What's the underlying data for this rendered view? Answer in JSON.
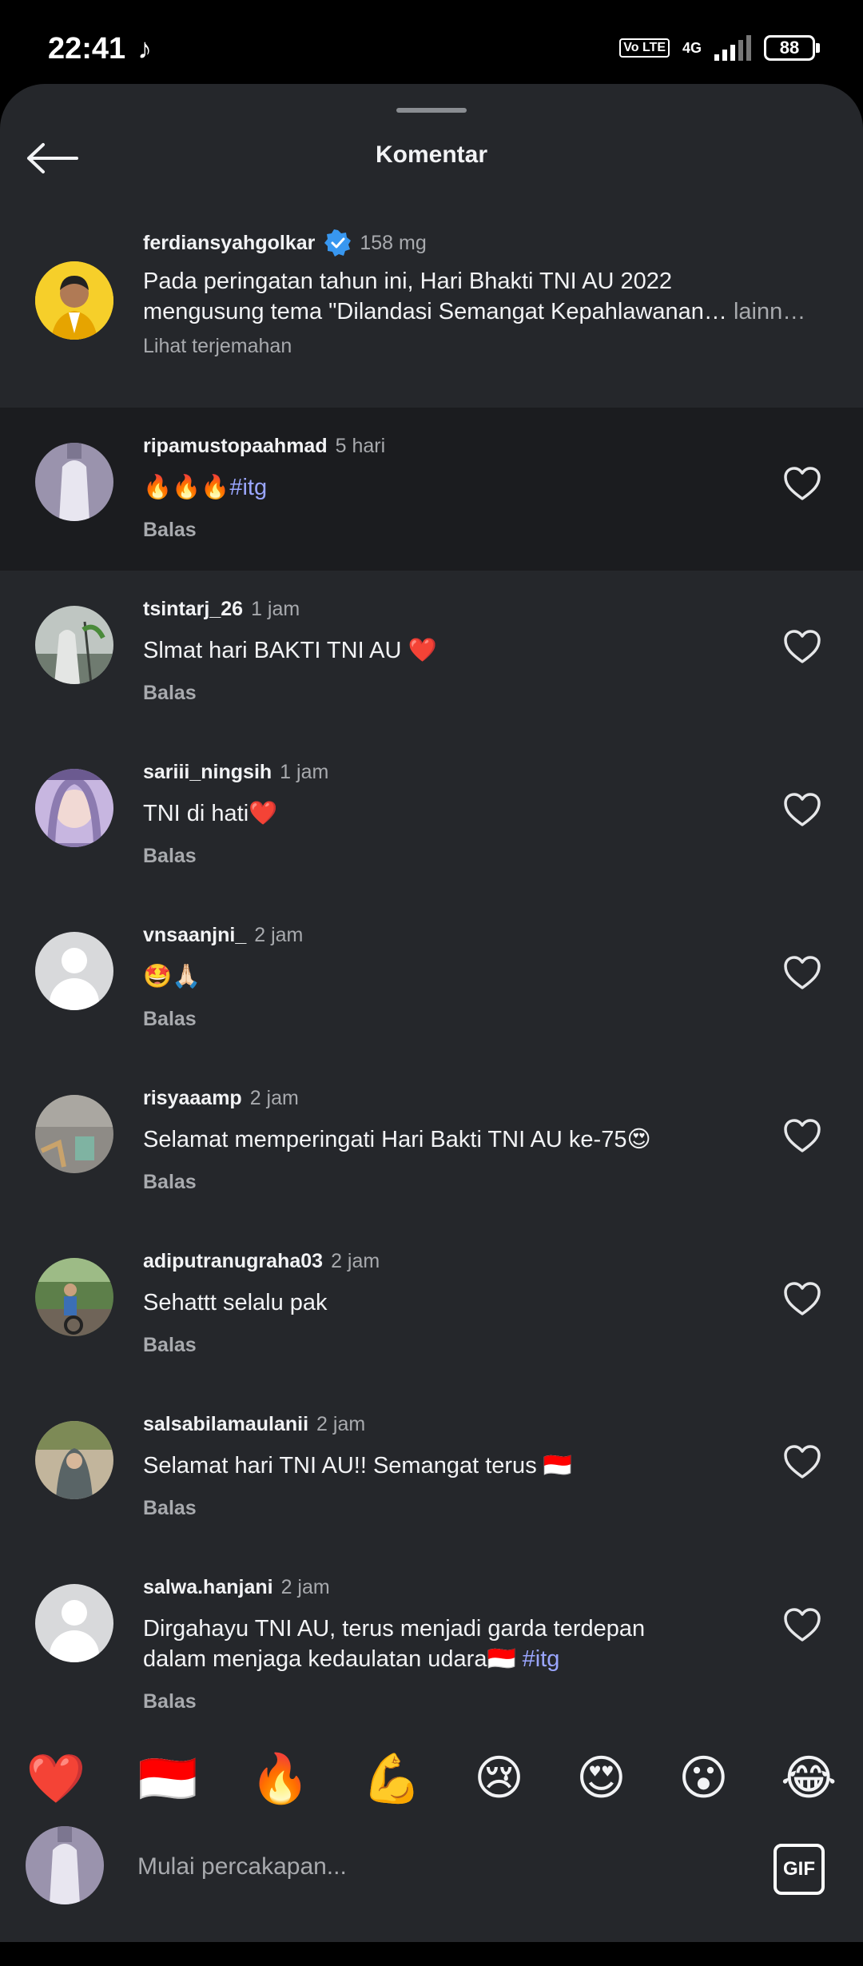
{
  "status": {
    "time": "22:41",
    "battery": "88",
    "volte": "Vo LTE",
    "network": "4G"
  },
  "header": {
    "title": "Komentar"
  },
  "caption": {
    "username": "ferdiansyahgolkar",
    "time": "158 mg",
    "text_line1": "Pada peringatan tahun ini, Hari Bhakti TNI AU 2022",
    "text_line2": "mengusung tema \"Dilandasi Semangat Kepahlawanan…",
    "more": "lainn…",
    "translate": "Lihat terjemahan"
  },
  "comments": [
    {
      "username": "ripamustopaahmad",
      "time": "5 hari",
      "text": "🔥🔥🔥",
      "hashtag": "#itg",
      "reply": "Balas"
    },
    {
      "username": "tsintarj_26",
      "time": "1 jam",
      "text": "Slmat hari BAKTI TNI AU ❤️",
      "reply": "Balas"
    },
    {
      "username": "sariii_ningsih",
      "time": "1 jam",
      "text": "TNI di hati❤️",
      "reply": "Balas"
    },
    {
      "username": "vnsaanjni_",
      "time": "2 jam",
      "text": "🤩🙏🏻",
      "reply": "Balas"
    },
    {
      "username": "risyaaamp",
      "time": "2 jam",
      "text": "Selamat memperingati Hari Bakti TNI AU ke-75😍",
      "reply": "Balas"
    },
    {
      "username": "adiputranugraha03",
      "time": "2 jam",
      "text": "Sehattt selalu pak",
      "reply": "Balas"
    },
    {
      "username": "salsabilamaulanii",
      "time": "2 jam",
      "text": "Selamat hari TNI AU!! Semangat terus 🇮🇩",
      "reply": "Balas"
    },
    {
      "username": "salwa.hanjani",
      "time": "2 jam",
      "text_line1": "Dirgahayu TNI AU, terus menjadi garda terdepan",
      "text_line2": "dalam menjaga kedaulatan udara🇮🇩",
      "hashtag": "#itg",
      "reply": "Balas"
    }
  ],
  "emojis": [
    "❤️",
    "🇮🇩",
    "🔥",
    "💪",
    "😢",
    "😍",
    "😮",
    "😂"
  ],
  "composer": {
    "placeholder": "Mulai percakapan...",
    "gif": "GIF"
  },
  "colors": {
    "sheet": "#25272b",
    "highlight": "#1b1c1f",
    "hashtag": "#9aa6ff",
    "verified": "#3897f0"
  }
}
